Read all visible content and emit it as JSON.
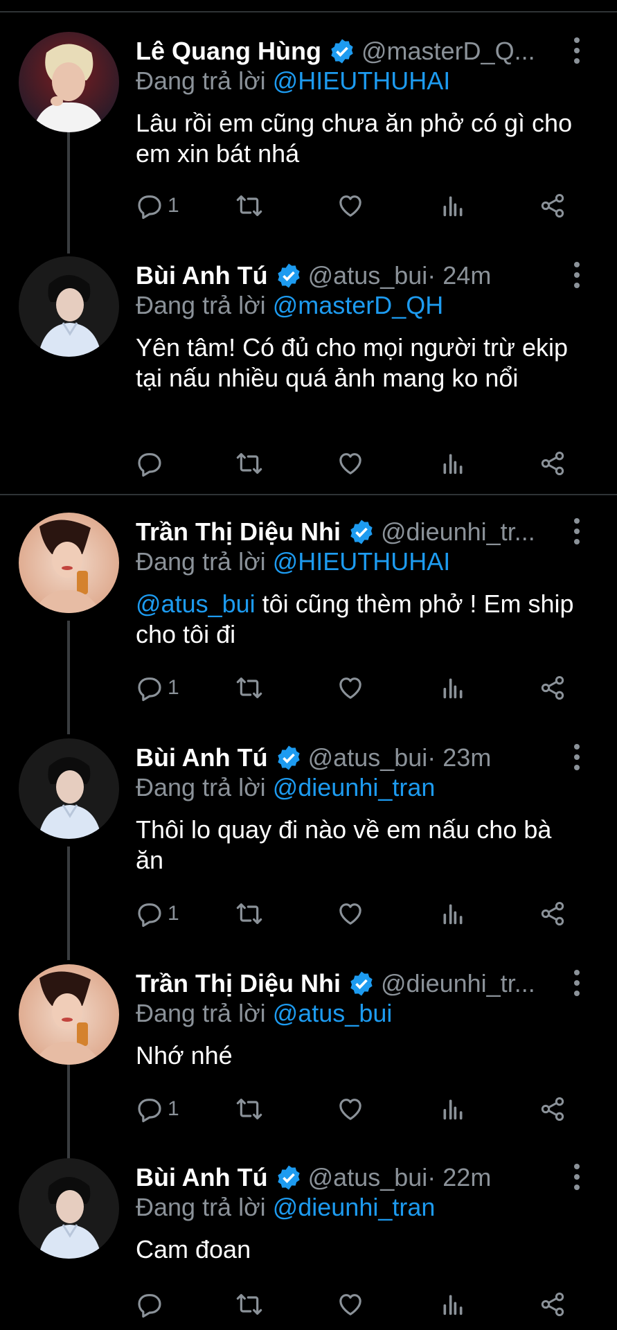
{
  "reply_prefix": "Đang trả lời",
  "tweets": [
    {
      "name": "Lê Quang Hùng",
      "handle": "@masterD_Q...",
      "time": "",
      "reply_to": "@HIEUTHUHAI",
      "text_mention": "",
      "text": "Lâu rồi em cũng chưa ăn phở có gì cho em xin bát nhá",
      "reply_count": "1"
    },
    {
      "name": "Bùi Anh Tú",
      "handle": "@atus_bui",
      "time": " · 24m",
      "reply_to": "@masterD_QH",
      "text_mention": "",
      "text": "Yên tâm! Có đủ cho mọi người trừ ekip tại nấu nhiều quá ảnh mang ko nổi",
      "reply_count": ""
    },
    {
      "name": "Trần Thị Diệu Nhi",
      "handle": "@dieunhi_tr...",
      "time": "",
      "reply_to": "@HIEUTHUHAI",
      "text_mention": "@atus_bui",
      "text": " tôi cũng thèm phở ! Em ship cho tôi đi",
      "reply_count": "1"
    },
    {
      "name": "Bùi Anh Tú",
      "handle": "@atus_bui",
      "time": " · 23m",
      "reply_to": "@dieunhi_tran",
      "text_mention": "",
      "text": "Thôi lo quay đi nào về em nấu cho bà ăn",
      "reply_count": "1"
    },
    {
      "name": "Trần Thị Diệu Nhi",
      "handle": "@dieunhi_tr...",
      "time": "",
      "reply_to": "@atus_bui",
      "text_mention": "",
      "text": "Nhớ nhé",
      "reply_count": "1"
    },
    {
      "name": "Bùi Anh Tú",
      "handle": "@atus_bui",
      "time": " · 22m",
      "reply_to": "@dieunhi_tran",
      "text_mention": "",
      "text": "Cam đoan",
      "reply_count": ""
    }
  ],
  "icons": {
    "reply": "reply-icon",
    "retweet": "retweet-icon",
    "like": "heart-icon",
    "views": "views-icon",
    "share": "share-icon",
    "more": "more-icon",
    "verified": "verified-badge-icon"
  },
  "colors": {
    "background": "#000000",
    "link": "#1d9bf0",
    "secondary_text": "#8b9299",
    "verified": "#1d9bf0",
    "divider": "#2f3336"
  }
}
